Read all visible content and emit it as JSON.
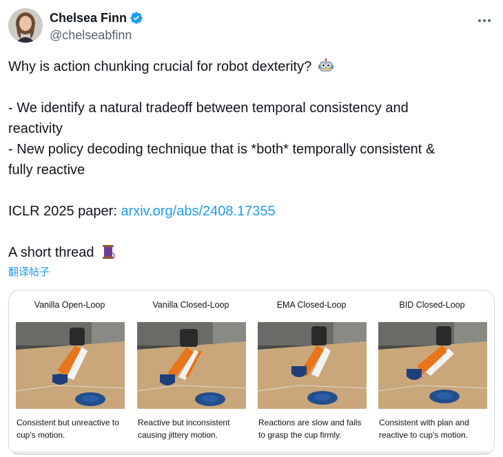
{
  "author": {
    "display_name": "Chelsea Finn",
    "handle": "@chelseabfinn",
    "verified": true,
    "avatar_icon": "avatar-photo"
  },
  "header": {
    "more_icon": "more-options-icon"
  },
  "post": {
    "line1": "Why is action chunking crucial for robot dexterity?",
    "line1_emoji": "robot-emoji",
    "bullet1_line1": "- We identify a natural tradeoff between temporal consistency and",
    "bullet1_line2": "reactivity",
    "bullet2_line1": "- New policy decoding technique that is *both* temporally consistent &",
    "bullet2_line2": "fully reactive",
    "paper_prefix": "ICLR 2025 paper: ",
    "paper_link": "arxiv.org/abs/2408.17355",
    "thread_text": "A short thread",
    "thread_emoji": "thread-spool-emoji"
  },
  "translate_label": "翻译帖子",
  "media": {
    "panels": [
      {
        "title": "Vanilla Open-Loop",
        "caption_line1": "Consistent but unreactive to",
        "caption_line2": "cup's motion."
      },
      {
        "title": "Vanilla Closed-Loop",
        "caption_line1": "Reactive but inconsistent",
        "caption_line2": "causing jittery motion."
      },
      {
        "title": "EMA Closed-Loop",
        "caption_line1": "Reactions are slow and fails",
        "caption_line2": "to grasp the cup firmly."
      },
      {
        "title": "BID Closed-Loop",
        "caption_line1": "Consistent with plan and",
        "caption_line2": "reactive to cup's motion."
      }
    ],
    "colors": {
      "table": "#c9a77a",
      "robot_arm": "#e8751a",
      "cup": "#1f3f7a",
      "plate": "#234e8c"
    }
  },
  "colors": {
    "link": "#1d9bf0",
    "text": "#0f1419",
    "secondary": "#536471",
    "verified_badge": "#1d9bf0"
  }
}
